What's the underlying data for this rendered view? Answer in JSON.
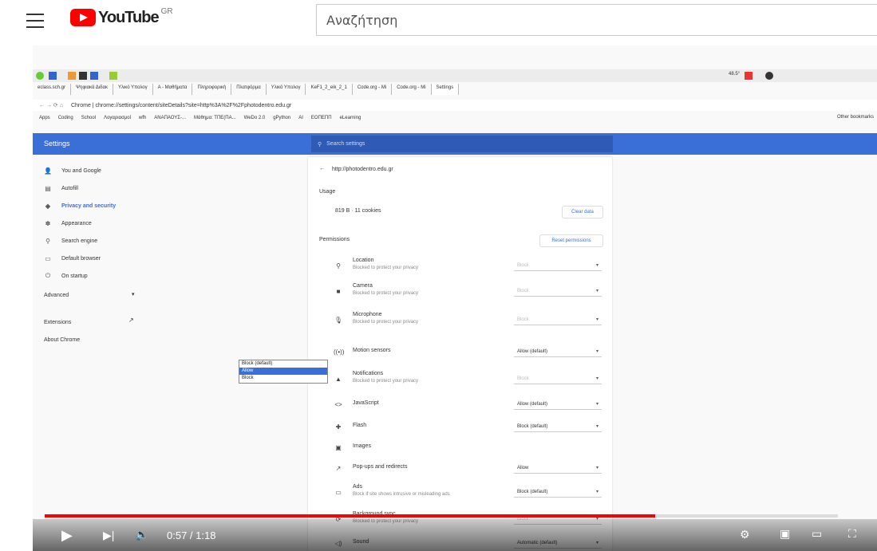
{
  "youtube": {
    "logo_text": "YouTube",
    "region": "GR",
    "search_placeholder": "Αναζήτηση"
  },
  "browser": {
    "tabs": [
      "eclass.sch.gr",
      "Ψηφιακά Διδακ",
      "Υλικό Υπολογ",
      "A - Μαθήματα",
      "Πληροφορική",
      "Πλατφόρμα",
      "Υλικό Υπολογ",
      "KeF1_2_eik_2_1",
      "Code.org - Mi",
      "Code.org - Mi",
      "Settings"
    ],
    "address": "Chrome | chrome://settings/content/siteDetails?site=http%3A%2F%2Fphotodentro.edu.gr",
    "bookmarks": [
      "Apps",
      "Coding",
      "School",
      "Λογαριασμοί",
      "wfh",
      "ΑΝΑΠΑΟΥΣ-...",
      "Μάθημα: ΤΠΕ(ΠΑ...",
      "WeDo 2.0",
      "gPython",
      "AI",
      "ΕΟΠΕΠΠ",
      "eLearning"
    ],
    "other_bookmarks": "Other bookmarks",
    "battery": "48.5°"
  },
  "settings": {
    "title": "Settings",
    "search_placeholder": "Search settings",
    "sidebar": [
      {
        "label": "You and Google",
        "icon": "person-icon"
      },
      {
        "label": "Autofill",
        "icon": "autofill-icon"
      },
      {
        "label": "Privacy and security",
        "icon": "shield-icon"
      },
      {
        "label": "Appearance",
        "icon": "palette-icon"
      },
      {
        "label": "Search engine",
        "icon": "search-icon"
      },
      {
        "label": "Default browser",
        "icon": "browser-icon"
      },
      {
        "label": "On startup",
        "icon": "power-icon"
      }
    ],
    "advanced": "Advanced",
    "extensions": "Extensions",
    "about": "About Chrome",
    "site_url": "http://photodentro.edu.gr",
    "usage_heading": "Usage",
    "usage_value": "819 B · 11 cookies",
    "clear_data": "Clear data",
    "permissions_heading": "Permissions",
    "reset_permissions": "Reset permissions",
    "permissions": [
      {
        "name": "Location",
        "sub": "Blocked to protect your privacy",
        "value": "Block",
        "disabled": true,
        "icon": "location-icon"
      },
      {
        "name": "Camera",
        "sub": "Blocked to protect your privacy",
        "value": "Block",
        "disabled": true,
        "icon": "camera-icon"
      },
      {
        "name": "Microphone",
        "sub": "Blocked to protect your privacy",
        "value": "Block",
        "disabled": true,
        "icon": "microphone-icon"
      },
      {
        "name": "Motion sensors",
        "sub": "",
        "value": "Allow (default)",
        "disabled": false,
        "icon": "motion-icon"
      },
      {
        "name": "Notifications",
        "sub": "Blocked to protect your privacy",
        "value": "Block",
        "disabled": true,
        "icon": "bell-icon"
      },
      {
        "name": "JavaScript",
        "sub": "",
        "value": "Allow (default)",
        "disabled": false,
        "icon": "code-icon"
      },
      {
        "name": "Flash",
        "sub": "",
        "value": "Block (default)",
        "disabled": false,
        "icon": "puzzle-icon"
      },
      {
        "name": "Images",
        "sub": "",
        "value": "",
        "disabled": false,
        "icon": "image-icon"
      },
      {
        "name": "Pop-ups and redirects",
        "sub": "",
        "value": "Allow",
        "disabled": false,
        "icon": "popup-icon"
      },
      {
        "name": "Ads",
        "sub": "Block if site shows intrusive or misleading ads",
        "value": "Block (default)",
        "disabled": false,
        "icon": "ads-icon"
      },
      {
        "name": "Background sync",
        "sub": "Blocked to protect your privacy",
        "value": "Block",
        "disabled": true,
        "icon": "sync-icon"
      },
      {
        "name": "Sound",
        "sub": "",
        "value": "Automatic (default)",
        "disabled": false,
        "icon": "sound-icon"
      }
    ],
    "dropdown_options": [
      "Block (default)",
      "Allow",
      "Block"
    ],
    "dropdown_selected": "Allow"
  },
  "player": {
    "time": "0:57 / 1:18",
    "progress": 0.77,
    "accent": "#ff0000"
  }
}
